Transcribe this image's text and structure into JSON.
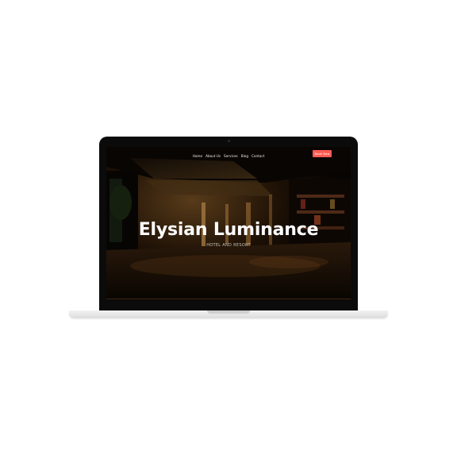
{
  "nav": {
    "items": [
      "Home",
      "About Us",
      "Services",
      "Blog",
      "Contact"
    ]
  },
  "cta": {
    "label": "Book Now"
  },
  "hero": {
    "title": "Elysian Luminance",
    "subtitle": "HOTEL AND RESORT"
  },
  "colors": {
    "accent": "#ff5a52",
    "bezel": "#0b0b0b",
    "base": "#e6e6e6"
  }
}
